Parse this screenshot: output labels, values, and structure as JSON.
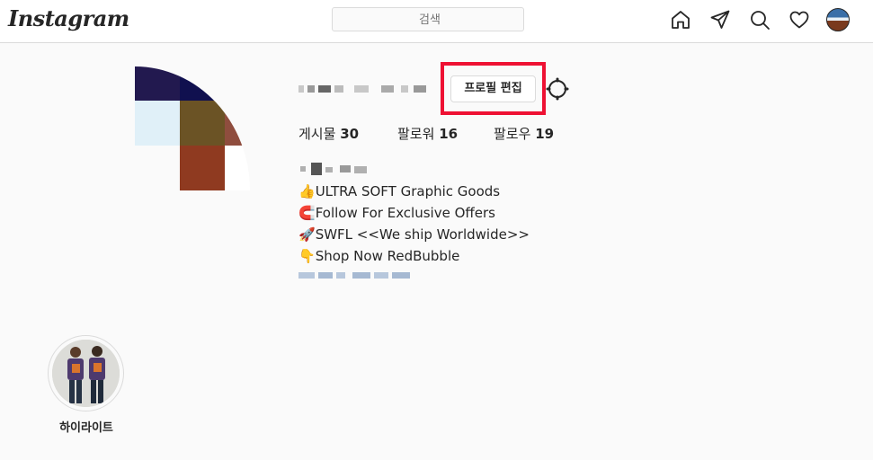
{
  "header": {
    "logo": "Instagram",
    "search_placeholder": "검색",
    "icons": [
      "home-icon",
      "direct-icon",
      "explore-icon",
      "activity-heart-icon",
      "profile-avatar-icon"
    ]
  },
  "profile": {
    "edit_button": "프로필 편집",
    "stats": {
      "posts_label": "게시물",
      "posts_count": "30",
      "followers_label": "팔로워",
      "followers_count": "16",
      "following_label": "팔로우",
      "following_count": "19"
    },
    "bio": [
      {
        "emoji": "👍",
        "text": "ULTRA SOFT Graphic Goods"
      },
      {
        "emoji": "🧲",
        "text": "Follow For Exclusive Offers"
      },
      {
        "emoji": "🚀",
        "text": "SWFL <<We ship Worldwide>>"
      },
      {
        "emoji": "👇",
        "text": "Shop Now RedBubble"
      }
    ]
  },
  "highlights": [
    {
      "label": "하이라이트"
    }
  ],
  "colors": {
    "highlight_box": "#ee1133",
    "border": "#dbdbdb",
    "text": "#262626"
  }
}
